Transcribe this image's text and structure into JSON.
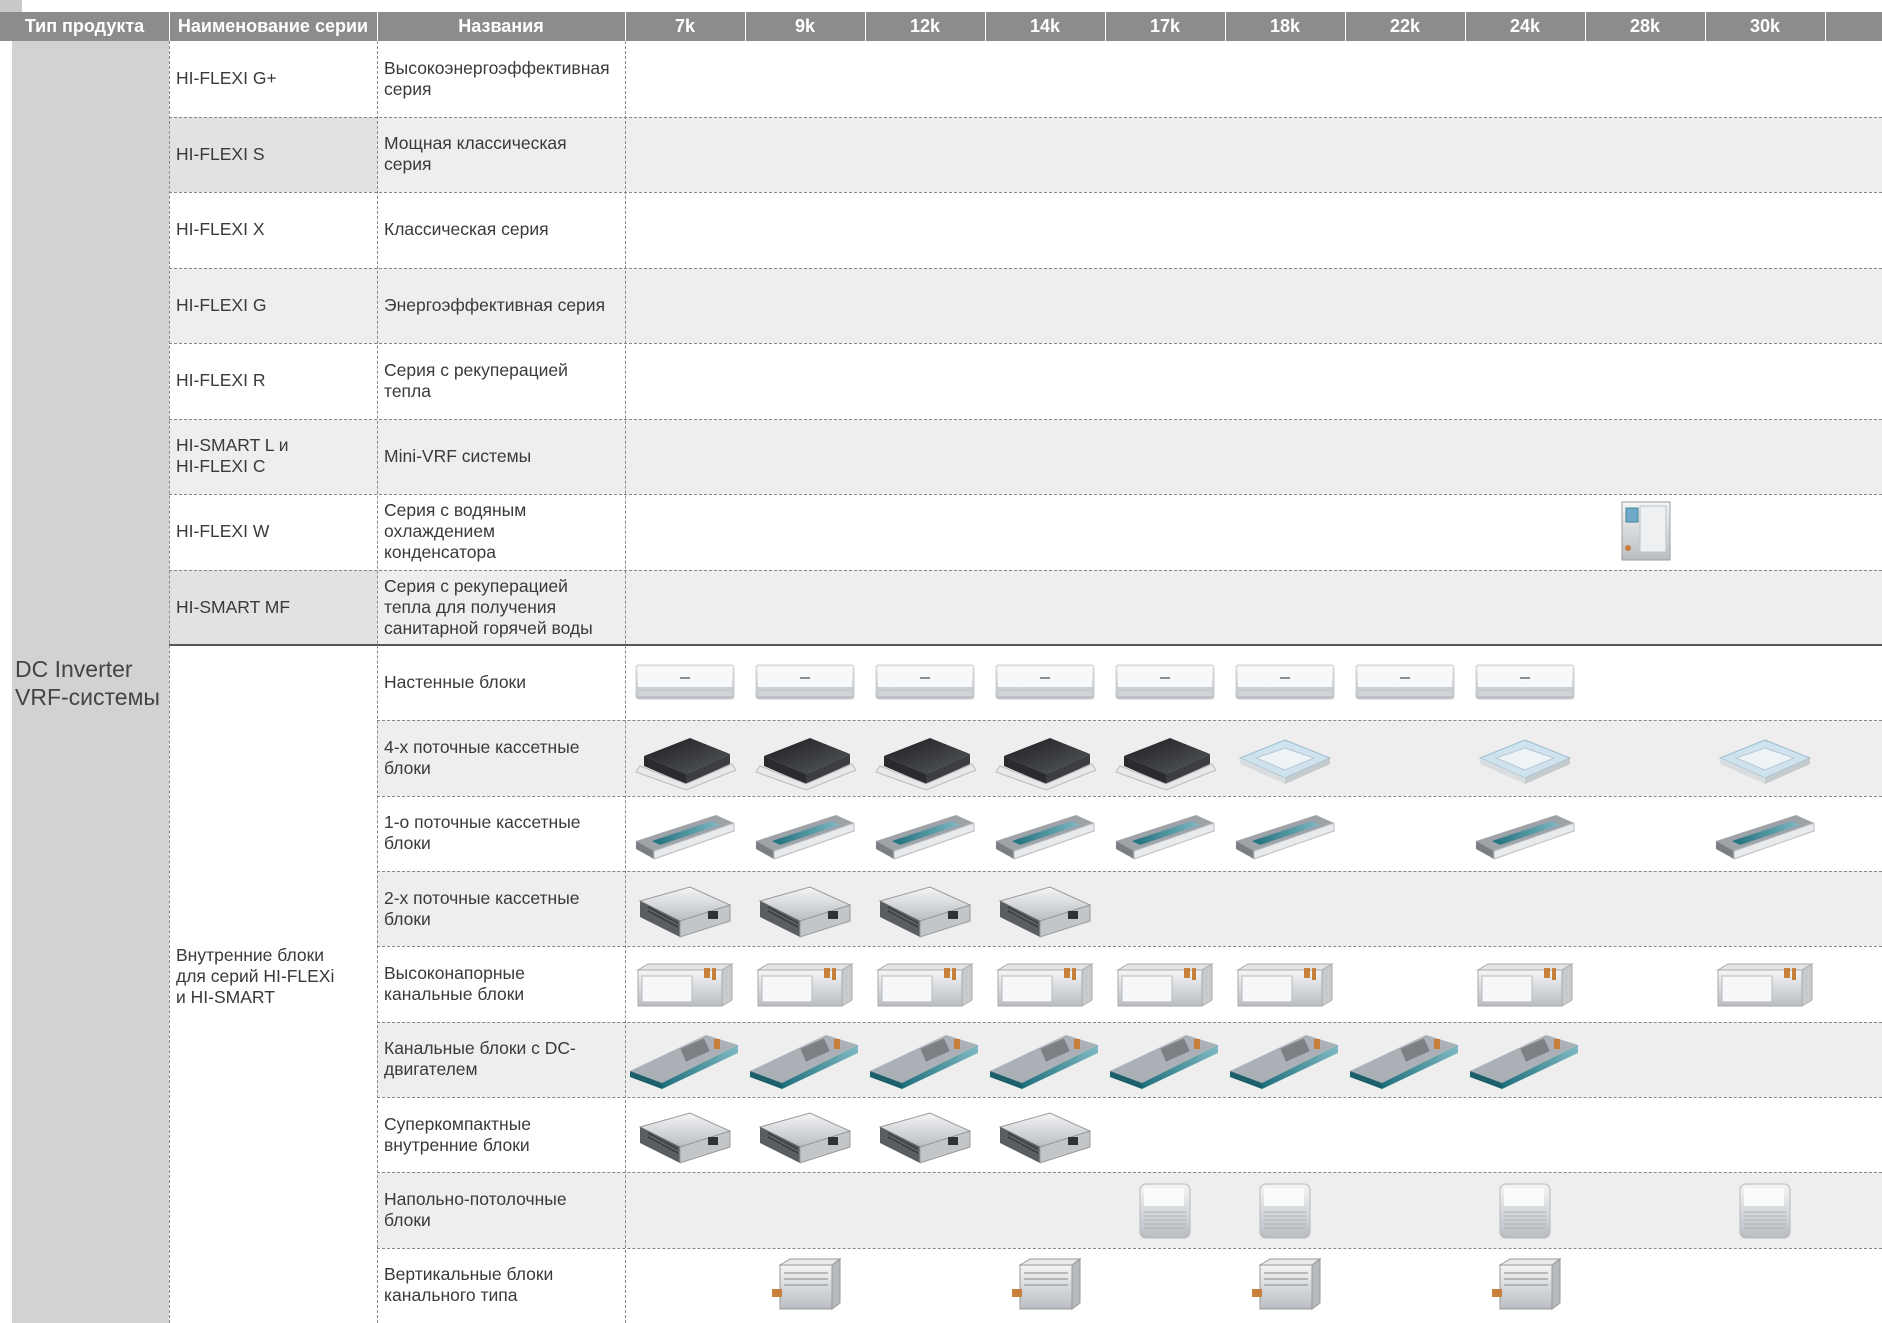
{
  "header": {
    "product_type": "Тип продукта",
    "series_name": "Наименование серии",
    "names": "Названия",
    "capacities": [
      "7k",
      "9k",
      "12k",
      "14k",
      "17k",
      "18k",
      "22k",
      "24k",
      "28k",
      "30k"
    ]
  },
  "product_type": {
    "line1": "DC Inverter",
    "line2": "VRF-системы"
  },
  "outdoor_rows": [
    {
      "series": [
        "HI-FLEXI G+"
      ],
      "name": [
        "Высокоэнергоэффективная",
        "серия"
      ]
    },
    {
      "series": [
        "HI-FLEXI S"
      ],
      "name": [
        "Мощная классическая",
        "серия"
      ]
    },
    {
      "series": [
        "HI-FLEXI X"
      ],
      "name": [
        "Классическая серия"
      ]
    },
    {
      "series": [
        "HI-FLEXI G"
      ],
      "name": [
        "Энергоэффективная серия"
      ]
    },
    {
      "series": [
        "HI-FLEXI R"
      ],
      "name": [
        "Серия с рекуперацией",
        "тепла"
      ]
    },
    {
      "series": [
        "HI-SMART L и",
        "HI-FLEXI C"
      ],
      "name": [
        "Mini-VRF системы"
      ]
    },
    {
      "series": [
        "HI-FLEXI W"
      ],
      "name": [
        "Серия с водяным",
        "охлаждением",
        "конденсатора"
      ]
    },
    {
      "series": [
        "HI-SMART MF"
      ],
      "name": [
        "Серия с рекуперацией",
        "тепла для получения",
        "санитарной горячей воды"
      ]
    }
  ],
  "indoor_series": [
    "Внутренние блоки",
    "для серий HI-FLEXi",
    "и HI-SMART"
  ],
  "indoor_rows": [
    {
      "name": [
        "Настенные блоки"
      ],
      "icon": "wall-unit",
      "cols": [
        "7k",
        "9k",
        "12k",
        "14k",
        "17k",
        "18k",
        "22k",
        "24k"
      ]
    },
    {
      "name": [
        "4-х поточные кассетные",
        "блоки"
      ],
      "icon": "cassette-4way",
      "cols": [
        "7k",
        "9k",
        "12k",
        "14k",
        "17k",
        "18k",
        "24k",
        "30k"
      ]
    },
    {
      "name": [
        "1-о поточные кассетные",
        "блоки"
      ],
      "icon": "cassette-1way",
      "cols": [
        "7k",
        "9k",
        "12k",
        "14k",
        "17k",
        "18k",
        "24k",
        "30k"
      ]
    },
    {
      "name": [
        "2-х поточные кассетные",
        "блоки"
      ],
      "icon": "cassette-2way",
      "cols": [
        "7k",
        "9k",
        "12k",
        "14k"
      ]
    },
    {
      "name": [
        "Высоконапорные",
        "канальные блоки"
      ],
      "icon": "high-pressure-duct",
      "cols": [
        "7k",
        "9k",
        "12k",
        "14k",
        "17k",
        "18k",
        "24k",
        "30k"
      ]
    },
    {
      "name": [
        "Канальные блоки с DC-",
        "двигателем"
      ],
      "icon": "dc-duct",
      "cols": [
        "7k",
        "9k",
        "12k",
        "14k",
        "17k",
        "18k",
        "22k",
        "24k"
      ]
    },
    {
      "name": [
        "Суперкомпактные",
        "внутренние блоки"
      ],
      "icon": "compact-duct",
      "cols": [
        "7k",
        "9k",
        "12k",
        "14k"
      ]
    },
    {
      "name": [
        "Напольно-потолочные",
        "блоки"
      ],
      "icon": "floor-ceiling",
      "cols": [
        "17k",
        "18k",
        "24k",
        "30k"
      ]
    },
    {
      "name": [
        "Вертикальные блоки",
        "канального типа"
      ],
      "icon": "vertical-duct",
      "cols": [
        "9k",
        "14k",
        "18k",
        "24k"
      ]
    }
  ],
  "outdoor_units": [
    {
      "row": 6,
      "col": "28k",
      "icon": "water-cooled-unit"
    }
  ],
  "colors": {
    "header": "#8c8c8e",
    "type_column": "#d2d2d4",
    "band": "#eeeeef"
  }
}
